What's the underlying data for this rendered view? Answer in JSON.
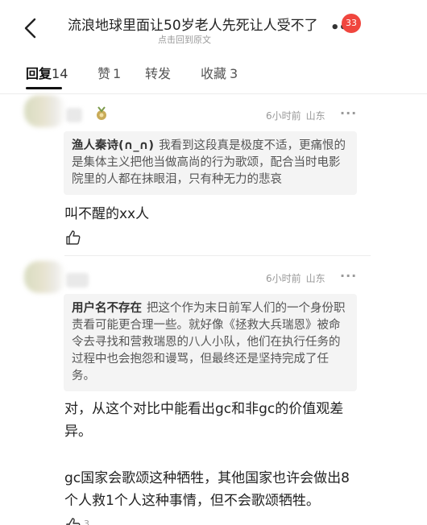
{
  "header": {
    "title": "流浪地球里面让50岁老人先死让人受不了",
    "subtitle": "点击回到原文",
    "notification_count": "33",
    "back_icon": "chevron-left-icon",
    "more_icon": "more-dots-icon"
  },
  "tabs": [
    {
      "label": "回复",
      "count": "14",
      "active": true
    },
    {
      "label": "赞",
      "count": "1",
      "active": false
    },
    {
      "label": "转发",
      "count": "",
      "active": false
    },
    {
      "label": "收藏",
      "count": "3",
      "active": false
    }
  ],
  "comments": [
    {
      "author": "",
      "time": "6小时前",
      "location": "山东",
      "quote_author": "渔人秦诗(∩_∩)",
      "quote_text": "我看到这段真是极度不适，更痛恨的是集体主义把他当做高尚的行为歌颂，配合当时电影院里的人都在抹眼泪，只有种无力的悲哀",
      "text": "叫不醒的xx人",
      "likes": ""
    },
    {
      "author": "",
      "time": "6小时前",
      "location": "山东",
      "quote_author": "用户名不存在",
      "quote_text": "把这个作为末日前军人们的一个身份职责看可能更合理一些。就好像《拯救大兵瑞恩》被命令去寻找和营救瑞恩的八人小队，他们在执行任务的过程中也会抱怨和谩骂，但最终还是坚持完成了任务。",
      "text_p1": "对，从这个对比中能看出gc和非gc的价值观差异。",
      "text_p2": "gc国家会歌颂这种牺牲，其他国家也许会做出8个人救1个人这种事情，但不会歌颂牺牲。",
      "likes": "3"
    }
  ],
  "colors": {
    "badge": "#f0463e",
    "quote_bg": "#f4f4f4",
    "muted_text": "#999999"
  }
}
